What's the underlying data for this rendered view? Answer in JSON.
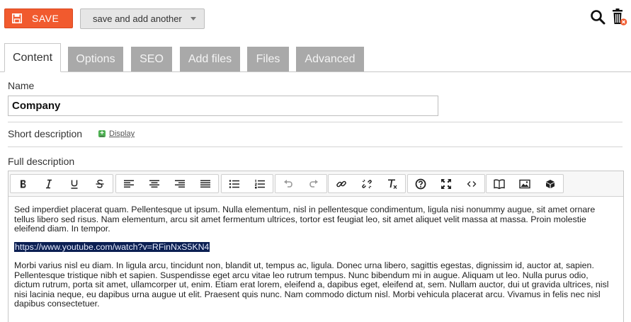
{
  "toolbar": {
    "save_label": "SAVE",
    "save_another_label": "save and add another",
    "icons": [
      "save-icon",
      "search-icon",
      "trash-icon"
    ],
    "accent_color": "#f15a2e"
  },
  "tabs": [
    {
      "label": "Content",
      "active": true
    },
    {
      "label": "Options",
      "active": false
    },
    {
      "label": "SEO",
      "active": false
    },
    {
      "label": "Add files",
      "active": false
    },
    {
      "label": "Files",
      "active": false
    },
    {
      "label": "Advanced",
      "active": false
    }
  ],
  "form": {
    "name_label": "Name",
    "name_value": "Company",
    "short_description_label": "Short description",
    "display_link": "Display",
    "full_description_label": "Full description"
  },
  "editor": {
    "toolbar_icons": [
      "bold-icon",
      "italic-icon",
      "underline-icon",
      "strikethrough-icon",
      "align-left-icon",
      "align-center-icon",
      "align-right-icon",
      "align-justify-icon",
      "bullet-list-icon",
      "numbered-list-icon",
      "undo-icon",
      "redo-icon",
      "link-icon",
      "unlink-icon",
      "clear-format-icon",
      "help-icon",
      "fullscreen-icon",
      "source-code-icon",
      "book-icon",
      "image-icon",
      "box-icon"
    ],
    "paragraph1": "Sed imperdiet placerat quam. Pellentesque ut ipsum. Nulla elementum, nisl in pellentesque condimentum, ligula nisi nonummy augue, sit amet ornare tellus libero sed risus. Nam elementum, arcu sit amet fermentum ultrices, tortor est feugiat leo, sit amet aliquet velit massa at massa. Proin molestie eleifend diam. In tempor.",
    "selected_link": "https://www.youtube.com/watch?v=RFinNxS5KN4",
    "paragraph3": "Morbi varius nisl eu diam. In ligula arcu, tincidunt non, blandit ut, tempus ac, ligula. Donec urna libero, sagittis egestas, dignissim id, auctor at, sapien. Pellentesque tristique nibh et sapien. Suspendisse eget arcu vitae leo rutrum tempus. Nunc bibendum mi in augue. Aliquam ut leo. Nulla purus odio, dictum rutrum, porta sit amet, ullamcorper ut, enim. Etiam erat lorem, eleifend a, dapibus eget, eleifend at, sem. Nullam auctor, dui ut gravida ultrices, nisl nisi lacinia neque, eu dapibus urna augue ut elit. Praesent quis nunc. Nam commodo dictum nisl. Morbi vehicula placerat arcu. Vivamus in felis nec nisl dapibus consectetuer."
  }
}
